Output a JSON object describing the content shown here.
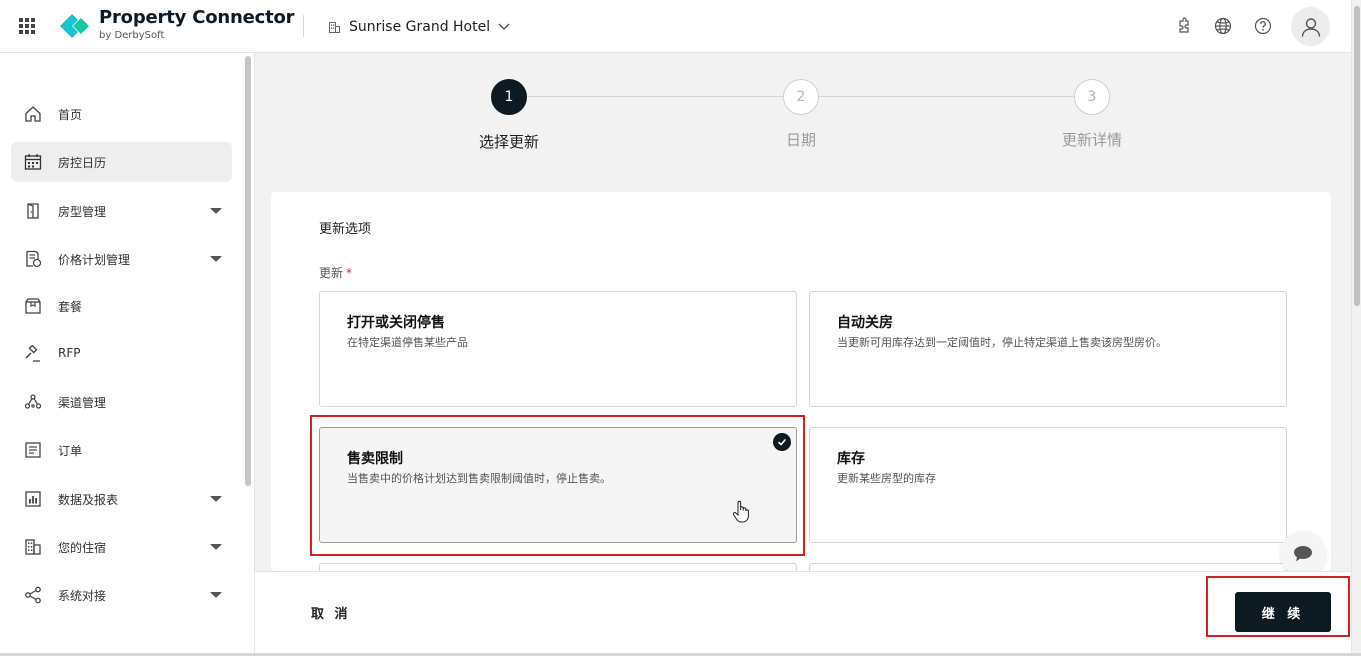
{
  "header": {
    "brand_title": "Property Connector",
    "brand_subtitle": "by DerbySoft",
    "hotel_name": "Sunrise Grand Hotel",
    "brand_color": "#16c3cf",
    "icons": [
      "apps-grid-icon",
      "plugin-icon",
      "globe-icon",
      "help-icon",
      "user-avatar-icon"
    ]
  },
  "sidebar": {
    "items": [
      {
        "label": "首页",
        "icon": "home-icon",
        "expandable": false,
        "active": false
      },
      {
        "label": "房控日历",
        "icon": "calendar-icon",
        "expandable": false,
        "active": true
      },
      {
        "label": "房型管理",
        "icon": "door-icon",
        "expandable": true,
        "active": false
      },
      {
        "label": "价格计划管理",
        "icon": "price-plan-icon",
        "expandable": true,
        "active": false
      },
      {
        "label": "套餐",
        "icon": "package-icon",
        "expandable": false,
        "active": false
      },
      {
        "label": "RFP",
        "icon": "gavel-icon",
        "expandable": false,
        "active": false
      },
      {
        "label": "渠道管理",
        "icon": "channel-icon",
        "expandable": false,
        "active": false
      },
      {
        "label": "订单",
        "icon": "order-icon",
        "expandable": false,
        "active": false
      },
      {
        "label": "数据及报表",
        "icon": "report-icon",
        "expandable": true,
        "active": false
      },
      {
        "label": "您的住宿",
        "icon": "building-icon",
        "expandable": true,
        "active": false
      },
      {
        "label": "系统对接",
        "icon": "share-icon",
        "expandable": true,
        "active": false
      }
    ]
  },
  "stepper": {
    "steps": [
      {
        "number": "1",
        "label": "选择更新",
        "state": "active"
      },
      {
        "number": "2",
        "label": "日期",
        "state": "pending"
      },
      {
        "number": "3",
        "label": "更新详情",
        "state": "pending"
      }
    ]
  },
  "panel": {
    "title": "更新选项",
    "field_label": "更新",
    "required_mark": "*",
    "options": [
      {
        "title": "打开或关闭停售",
        "desc": "在特定渠道停售某些产品",
        "selected": false
      },
      {
        "title": "自动关房",
        "desc": "当更新可用库存达到一定阈值时，停止特定渠道上售卖该房型房价。",
        "selected": false
      },
      {
        "title": "售卖限制",
        "desc": "当售卖中的价格计划达到售卖限制阈值时，停止售卖。",
        "selected": true
      },
      {
        "title": "库存",
        "desc": "更新某些房型的库存",
        "selected": false
      }
    ]
  },
  "footer": {
    "cancel_label": "取 消",
    "continue_label": "继 续"
  },
  "colors": {
    "primary": "#0e1a22",
    "highlight": "#d42020",
    "active_nav_bg": "#eeeeee"
  }
}
